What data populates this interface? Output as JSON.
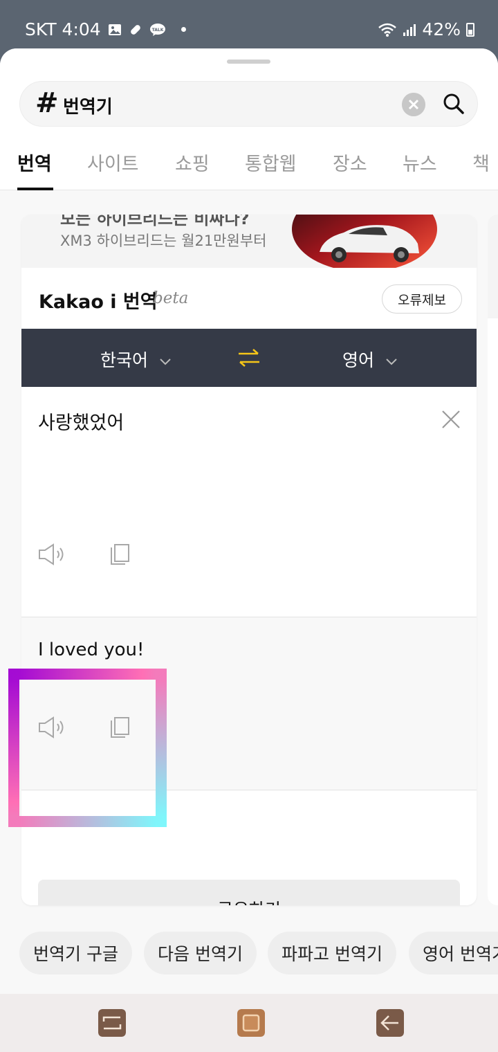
{
  "status_bar": {
    "carrier_time": "SKT 4:04",
    "talk_badge": "TALK",
    "battery": "42%",
    "icons": [
      "gallery-icon",
      "pill-icon",
      "talk-icon",
      "notification-dot",
      "wifi-icon",
      "signal-icon",
      "battery-icon"
    ]
  },
  "search": {
    "hash": "#",
    "query": "번역기"
  },
  "tabs": [
    {
      "label": "번역",
      "active": true
    },
    {
      "label": "사이트",
      "active": false
    },
    {
      "label": "쇼핑",
      "active": false
    },
    {
      "label": "통합웹",
      "active": false
    },
    {
      "label": "장소",
      "active": false
    },
    {
      "label": "뉴스",
      "active": false
    },
    {
      "label": "책",
      "active": false
    }
  ],
  "ad": {
    "headline": "모든 하이브리드는 비싸다?",
    "subtext": "XM3 하이브리드는 월21만원부터"
  },
  "translator": {
    "title": "Kakao i 번역",
    "beta": "beta",
    "report_label": "오류제보",
    "source_lang": "한국어",
    "target_lang": "영어",
    "source_text": "사랑했었어",
    "translated_text": "I loved you!",
    "share_label": "공유하기"
  },
  "related": [
    "번역기 구글",
    "다음 번역기",
    "파파고 번역기",
    "영어 번역기"
  ],
  "colors": {
    "lang_bar": "#353a47",
    "swap_icon": "#f5c518",
    "highlight_start": "#a40bd3",
    "highlight_mid": "#ff6fb5",
    "highlight_end": "#7ff6fb"
  }
}
